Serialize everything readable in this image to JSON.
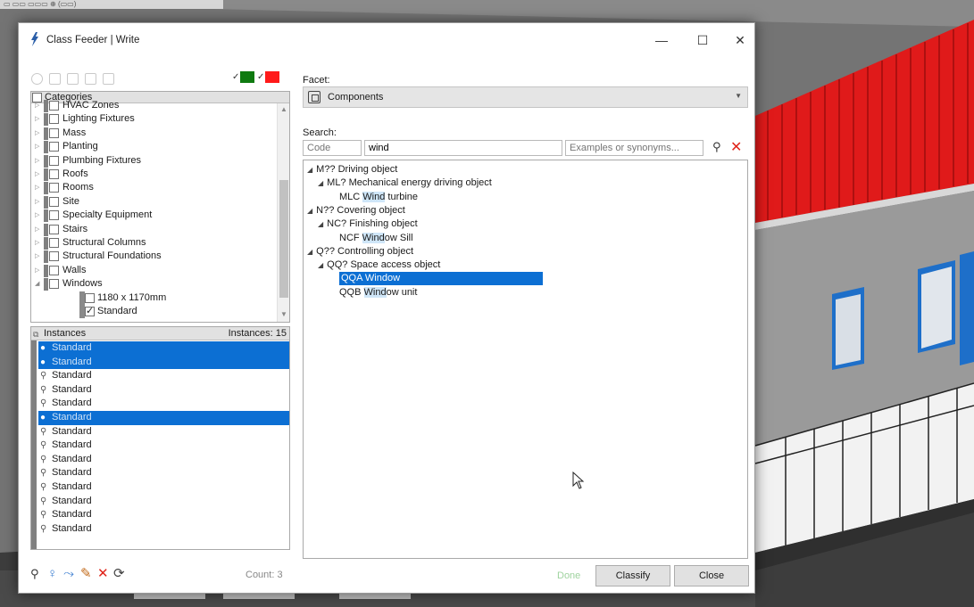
{
  "background": {
    "top_strip_text": "▭ ▭▭ ▭▭▭    ⊕ (▭▭)"
  },
  "window": {
    "title": "Class Feeder | Write",
    "minimize": "—",
    "maximize": "☐",
    "close": "✕"
  },
  "colors": {
    "accent_selection": "#0c6fd3",
    "chip_green": "#0f7a10",
    "chip_red": "#ff1a1a",
    "clear_red": "#e0241a"
  },
  "categories": {
    "header": "Categories",
    "items": [
      {
        "label": "HVAC Zones",
        "checked": false,
        "expanded": false
      },
      {
        "label": "Lighting Fixtures",
        "checked": false,
        "expanded": false
      },
      {
        "label": "Mass",
        "checked": false,
        "expanded": false
      },
      {
        "label": "Planting",
        "checked": false,
        "expanded": false
      },
      {
        "label": "Plumbing Fixtures",
        "checked": false,
        "expanded": false
      },
      {
        "label": "Roofs",
        "checked": false,
        "expanded": false
      },
      {
        "label": "Rooms",
        "checked": false,
        "expanded": false
      },
      {
        "label": "Site",
        "checked": false,
        "expanded": false
      },
      {
        "label": "Specialty Equipment",
        "checked": false,
        "expanded": false
      },
      {
        "label": "Stairs",
        "checked": false,
        "expanded": false
      },
      {
        "label": "Structural Columns",
        "checked": false,
        "expanded": false
      },
      {
        "label": "Structural Foundations",
        "checked": false,
        "expanded": false
      },
      {
        "label": "Walls",
        "checked": false,
        "expanded": false
      },
      {
        "label": "Windows",
        "checked": false,
        "expanded": true
      }
    ],
    "children": [
      {
        "label": "1180 x 1170mm",
        "checked": false
      },
      {
        "label": "Standard",
        "checked": true
      }
    ]
  },
  "instances": {
    "header": "Instances",
    "count_label": "Instances: 15",
    "rows": [
      {
        "label": "Standard",
        "selected": true
      },
      {
        "label": "Standard",
        "selected": true
      },
      {
        "label": "Standard",
        "selected": false
      },
      {
        "label": "Standard",
        "selected": false
      },
      {
        "label": "Standard",
        "selected": false
      },
      {
        "label": "Standard",
        "selected": true
      },
      {
        "label": "Standard",
        "selected": false
      },
      {
        "label": "Standard",
        "selected": false
      },
      {
        "label": "Standard",
        "selected": false
      },
      {
        "label": "Standard",
        "selected": false
      },
      {
        "label": "Standard",
        "selected": false
      },
      {
        "label": "Standard",
        "selected": false
      },
      {
        "label": "Standard",
        "selected": false
      },
      {
        "label": "Standard",
        "selected": false
      }
    ]
  },
  "bottom_toolbar": {
    "icons": [
      "binoculars-icon",
      "bulb-icon",
      "link-icon",
      "brush-icon",
      "delete-icon",
      "refresh-icon"
    ],
    "glyphs": [
      "🔭",
      "💡",
      "⤳",
      "🖌",
      "✕",
      "⟳"
    ],
    "count": "Count: 3"
  },
  "facet": {
    "label": "Facet:",
    "value": "Components"
  },
  "search": {
    "label": "Search:",
    "code_placeholder": "Code",
    "term": "wind",
    "examples_placeholder": "Examples or synonyms..."
  },
  "results": [
    {
      "indent": 0,
      "tri": "◢",
      "pre": "M?? Driving object",
      "hit": "",
      "post": "",
      "selected": false
    },
    {
      "indent": 1,
      "tri": "◢",
      "pre": "ML? Mechanical energy driving object",
      "hit": "",
      "post": "",
      "selected": false
    },
    {
      "indent": 2,
      "tri": "",
      "pre": "MLC ",
      "hit": "Wind",
      "post": " turbine",
      "selected": false
    },
    {
      "indent": 0,
      "tri": "◢",
      "pre": "N?? Covering object",
      "hit": "",
      "post": "",
      "selected": false
    },
    {
      "indent": 1,
      "tri": "◢",
      "pre": "NC? Finishing object",
      "hit": "",
      "post": "",
      "selected": false
    },
    {
      "indent": 2,
      "tri": "",
      "pre": "NCF ",
      "hit": "Wind",
      "post": "ow Sill",
      "selected": false
    },
    {
      "indent": 0,
      "tri": "◢",
      "pre": "Q?? Controlling object",
      "hit": "",
      "post": "",
      "selected": false
    },
    {
      "indent": 1,
      "tri": "◢",
      "pre": "QQ? Space access object",
      "hit": "",
      "post": "",
      "selected": false
    },
    {
      "indent": 2,
      "tri": "",
      "pre": "QQA ",
      "hit": "Wind",
      "post": "ow",
      "selected": true
    },
    {
      "indent": 2,
      "tri": "",
      "pre": "QQB ",
      "hit": "Wind",
      "post": "ow unit",
      "selected": false
    }
  ],
  "footer": {
    "done": "Done",
    "classify": "Classify",
    "close": "Close"
  }
}
